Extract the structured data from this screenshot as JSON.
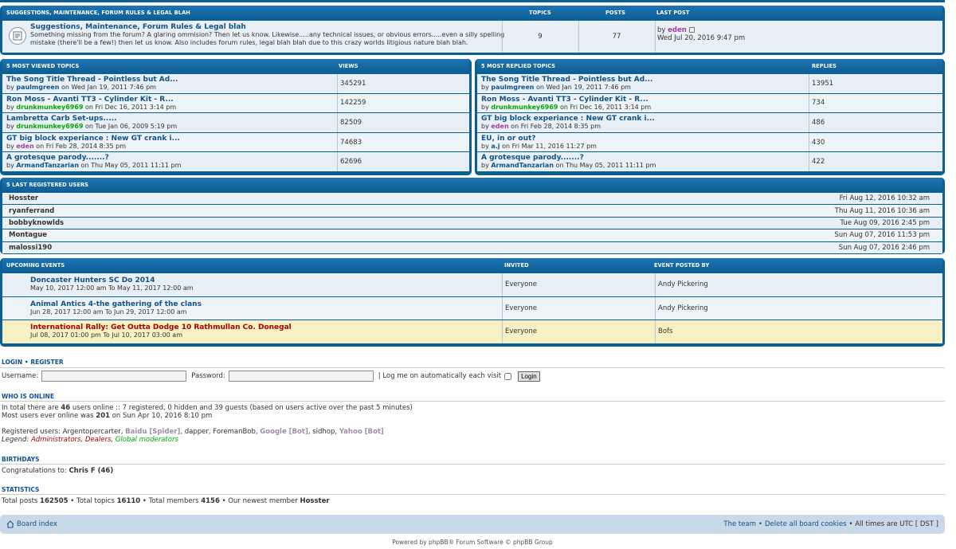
{
  "forum_panel": {
    "headers": {
      "name": "SUGGESTIONS, MAINTENANCE, FORUM RULES & LEGAL BLAH",
      "topics": "TOPICS",
      "posts": "POSTS",
      "last_post": "LAST POST"
    },
    "title": "Suggestions, Maintenance, Forum Rules & Legal blah",
    "desc": "Something missing from the forum? A glaring ommision? Then let us know. Likewise.....any technical issues, or obvious errors.....even a silly spelling mistake (there'll be a few!) then let us know. Also includes forum rules, legal blah blah due to this crazy worlds litigious nature blah blah.",
    "topics": "9",
    "posts": "77",
    "last_by_prefix": "by",
    "last_by": "eden",
    "last_date": "Wed Jul 20, 2016 9:47 pm"
  },
  "viewed": {
    "header": "5 MOST VIEWED TOPICS",
    "col": "VIEWS",
    "rows": [
      {
        "title": "The Song Title Thread - Pointless but Ad...",
        "by": "paulmgreen",
        "date": "on Wed Jan 19, 2011 7:46 pm",
        "value": "345291"
      },
      {
        "title": "Ron Moss - Avanti TT3 - Cylinder Kit - R...",
        "by": "drunkmunkey6969",
        "date": "on Fri Dec 16, 2011 3:14 pm",
        "value": "142259"
      },
      {
        "title": "Lambretta Carb Set-ups.....",
        "by": "drunkmunkey6969",
        "date": "on Tue Jan 06, 2009 5:19 pm",
        "value": "82509"
      },
      {
        "title": "GT big block experiance : New GT crank i...",
        "by": "eden",
        "date": "on Fri Feb 28, 2014 8:35 pm",
        "value": "74683"
      },
      {
        "title": "A grotesque parody.......?",
        "by": "ArmandTanzarian",
        "date": "on Thu May 05, 2011 11:11 pm",
        "value": "62696"
      }
    ]
  },
  "replied": {
    "header": "5 MOST REPLIED TOPICS",
    "col": "REPLIES",
    "rows": [
      {
        "title": "The Song Title Thread - Pointless but Ad...",
        "by": "paulmgreen",
        "date": "on Wed Jan 19, 2011 7:46 pm",
        "value": "13951"
      },
      {
        "title": "Ron Moss - Avanti TT3 - Cylinder Kit - R...",
        "by": "drunkmunkey6969",
        "date": "on Fri Dec 16, 2011 3:14 pm",
        "value": "734"
      },
      {
        "title": "GT big block experiance : New GT crank i...",
        "by": "eden",
        "date": "on Fri Feb 28, 2014 8:35 pm",
        "value": "486"
      },
      {
        "title": "EU, in or out?",
        "by": "a.j",
        "date": "on Fri Mar 11, 2016 11:27 pm",
        "value": "430"
      },
      {
        "title": "A grotesque parody.......?",
        "by": "ArmandTanzarian",
        "date": "on Thu May 05, 2011 11:11 pm",
        "value": "422"
      }
    ]
  },
  "registered": {
    "header": "5 LAST REGISTERED USERS",
    "rows": [
      {
        "name": "Hosster",
        "date": "Fri Aug 12, 2016 10:32 am"
      },
      {
        "name": "ryanferrand",
        "date": "Thu Aug 11, 2016 10:36 am"
      },
      {
        "name": "bobbyknowlds",
        "date": "Tue Aug 09, 2016 2:45 pm"
      },
      {
        "name": "Montague",
        "date": "Sun Aug 07, 2016 11:53 pm"
      },
      {
        "name": "malossi190",
        "date": "Sun Aug 07, 2016 2:46 pm"
      }
    ]
  },
  "events": {
    "headers": {
      "name": "UPCOMING EVENTS",
      "invited": "INVITED",
      "posted_by": "EVENT POSTED BY"
    },
    "rows": [
      {
        "title": "Doncaster Hunters SC Do 2014",
        "when": "May 10, 2017 12:00 am To May 11, 2017 12:00 am",
        "invited": "Everyone",
        "posted_by": "Andy Pickering"
      },
      {
        "title": "Animal Antics 4-the gathering of the clans",
        "when": "Jun 28, 2017 12:00 am To Jun 29, 2017 12:00 am",
        "invited": "Everyone",
        "posted_by": "Andy Pickering"
      },
      {
        "title": "International Rally: Get Outta Dodge 10 Rathmullan Co. Donegal",
        "when": "Jul 08, 2017 01:00 pm To Jul 10, 2017 03:00 am",
        "invited": "Everyone",
        "posted_by": "Bofs"
      }
    ]
  },
  "login": {
    "login_label": "LOGIN",
    "sep": "•",
    "register_label": "REGISTER",
    "username_label": "Username:",
    "password_label": "Password:",
    "remember_label": "| Log me on automatically each visit",
    "button": "Login"
  },
  "online": {
    "header": "WHO IS ONLINE",
    "line1_a": "In total there are",
    "line1_count": "46",
    "line1_b": "users online :: 7 registered, 0 hidden and 39 guests (based on users active over the past 5 minutes)",
    "line2_a": "Most users ever online was",
    "line2_count": "201",
    "line2_b": "on Sun Apr 10, 2016 8:10 pm",
    "reg_label": "Registered users:",
    "users": [
      {
        "name": "Argentopercarter",
        "type": "normal"
      },
      {
        "name": "Baidu [Spider]",
        "type": "bot"
      },
      {
        "name": "dapper",
        "type": "normal"
      },
      {
        "name": "ForemanBob",
        "type": "normal"
      },
      {
        "name": "Google [Bot]",
        "type": "bot"
      },
      {
        "name": "sidhop",
        "type": "normal"
      },
      {
        "name": "Yahoo [Bot]",
        "type": "bot"
      }
    ],
    "legend_label": "Legend:",
    "legend_admins": "Administrators",
    "legend_dealers": "Dealers",
    "legend_mods": "Global moderators"
  },
  "birthdays": {
    "header": "BIRTHDAYS",
    "label": "Congratulations to:",
    "name": "Chris F (46)"
  },
  "statistics": {
    "header": "STATISTICS",
    "posts_label": "Total posts",
    "posts": "162505",
    "topics_label": "• Total topics",
    "topics": "16110",
    "members_label": "• Total members",
    "members": "4156",
    "newest_label": "• Our newest member",
    "newest": "Hosster"
  },
  "footer": {
    "board_index": "Board index",
    "team": "The team",
    "sep": "•",
    "delete_cookies": "Delete all board cookies",
    "times": "• All times are UTC [ DST ]",
    "powered": "Powered by phpBB® Forum Software © phpBB Group"
  },
  "colors": {
    "panel": "#0a5f94",
    "link": "#105289",
    "green_user": "#00aa00",
    "highlight_row": "#f7f1c3"
  }
}
